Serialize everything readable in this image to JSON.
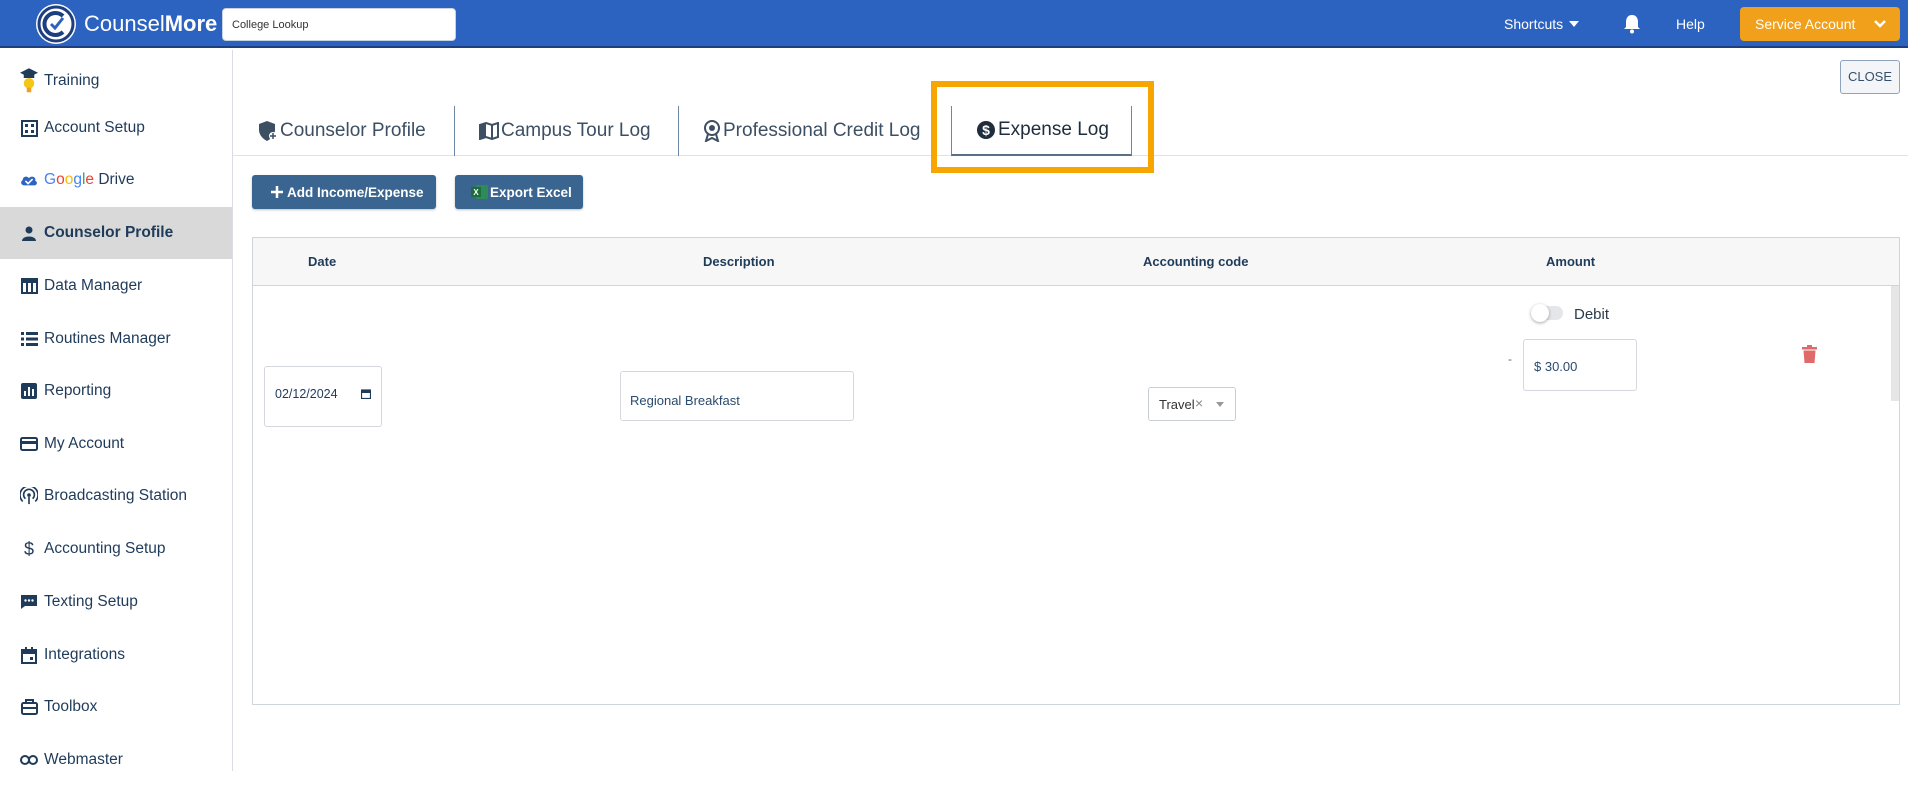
{
  "app": {
    "brand_light": "Counsel",
    "brand_bold": "More",
    "search_value": "College Lookup"
  },
  "topnav": {
    "shortcuts": "Shortcuts",
    "help": "Help",
    "service_account": "Service Account"
  },
  "sidebar": {
    "items": [
      {
        "label": "Training",
        "icon": "graduation-bulb-icon"
      },
      {
        "label": "Account Setup",
        "icon": "building-icon"
      },
      {
        "label": "Drive",
        "icon": "cloud-check-icon",
        "prefix": "Google"
      },
      {
        "label": "Counselor Profile",
        "icon": "person-icon",
        "active": true
      },
      {
        "label": "Data Manager",
        "icon": "table-icon"
      },
      {
        "label": "Routines Manager",
        "icon": "list-icon"
      },
      {
        "label": "Reporting",
        "icon": "bar-chart-icon"
      },
      {
        "label": "My Account",
        "icon": "credit-card-icon"
      },
      {
        "label": "Broadcasting Station",
        "icon": "broadcast-icon"
      },
      {
        "label": "Accounting Setup",
        "icon": "dollar-icon"
      },
      {
        "label": "Texting Setup",
        "icon": "chat-icon"
      },
      {
        "label": "Integrations",
        "icon": "calendar-icon"
      },
      {
        "label": "Toolbox",
        "icon": "toolbox-icon"
      },
      {
        "label": "Webmaster",
        "icon": "link-icon"
      }
    ],
    "google_letters": [
      "G",
      "o",
      "o",
      "g",
      "l",
      "e"
    ]
  },
  "close_label": "CLOSE",
  "tabs": [
    {
      "label": "Counselor Profile",
      "icon": "shield-icon"
    },
    {
      "label": "Campus Tour Log",
      "icon": "map-icon"
    },
    {
      "label": "Professional Credit Log",
      "icon": "award-icon"
    },
    {
      "label": "Expense Log",
      "icon": "dollar-circle-icon",
      "active": true
    }
  ],
  "actions": {
    "add": "Add Income/Expense",
    "export": "Export Excel"
  },
  "table": {
    "headers": [
      "Date",
      "Description",
      "Accounting code",
      "Amount"
    ],
    "rows": [
      {
        "date": "02/12/2024",
        "description": "Regional Breakfast",
        "accounting_code": "Travel",
        "toggle_label": "Debit",
        "sign": "-",
        "amount": "$ 30.00"
      }
    ]
  },
  "colors": {
    "topbar": "#2d63c0",
    "service_button": "#f0a01a",
    "primary_button": "#3a6591",
    "highlight": "#f7a500",
    "trash": "#e06a6a"
  }
}
